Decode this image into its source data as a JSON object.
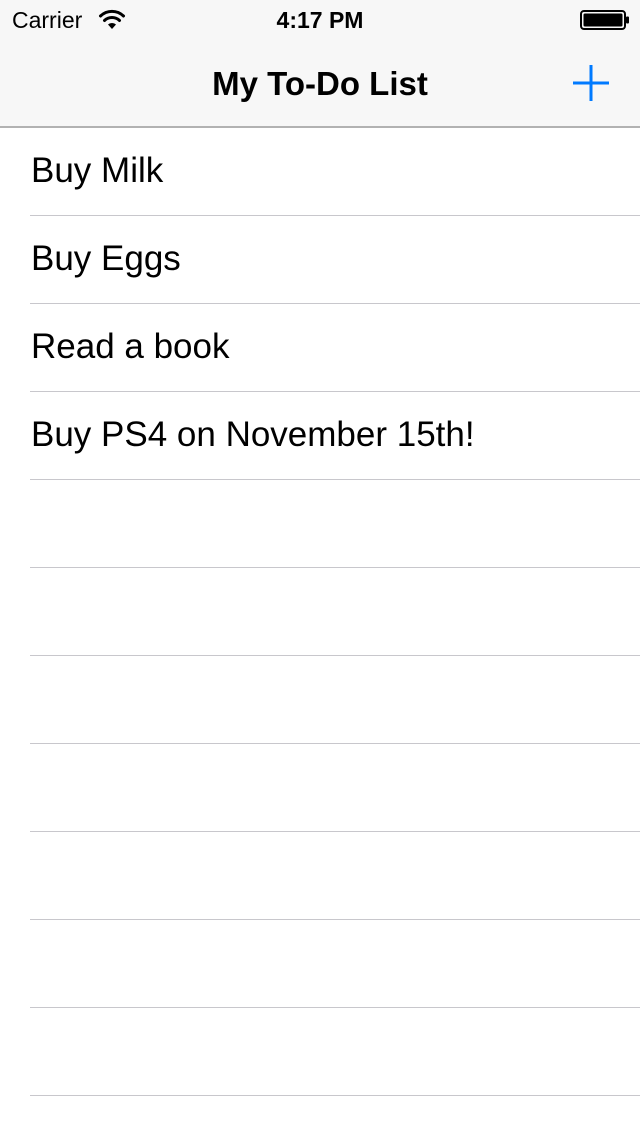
{
  "status_bar": {
    "carrier": "Carrier",
    "time": "4:17 PM",
    "wifi_icon": "wifi-icon",
    "battery_icon": "battery-full-icon"
  },
  "nav_bar": {
    "title": "My To-Do List",
    "add_icon": "plus-icon"
  },
  "todo_items": [
    "Buy Milk",
    "Buy Eggs",
    "Read a book",
    "Buy PS4 on November 15th!"
  ],
  "colors": {
    "tint": "#007aff",
    "nav_background": "#f7f7f7",
    "separator": "#c8c7cc"
  }
}
